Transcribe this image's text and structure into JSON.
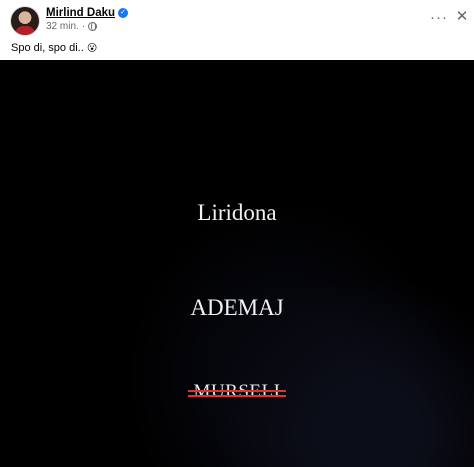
{
  "post": {
    "author": "Mirlind Daku",
    "time": "32 min.",
    "separator": "·",
    "caption": "Spo di, spo di..",
    "caption_emoji": "😮",
    "more_icon": "ellipsis-icon",
    "close_icon": "close-icon",
    "more_label": "···",
    "close_label": "✕"
  },
  "photo": {
    "line1": "Liridona",
    "line2": "ADEMAJ",
    "line3": "MURSELI",
    "strike_color": "#e0322e"
  }
}
